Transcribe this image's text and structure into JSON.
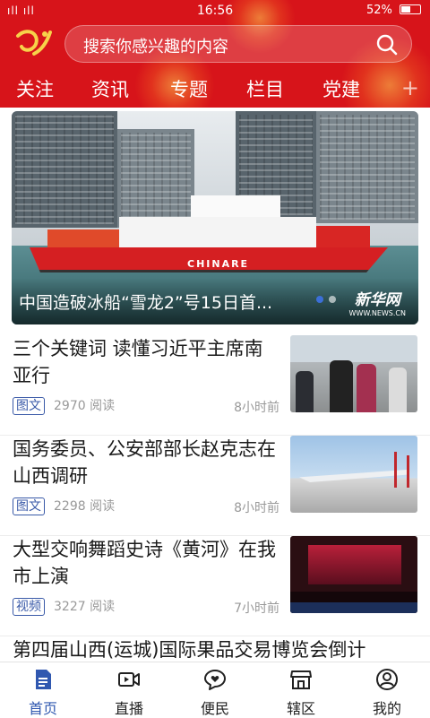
{
  "status_bar": {
    "time": "16:56",
    "battery": "52%",
    "signal": "ıll ıll",
    "battery_level": 0.52
  },
  "search": {
    "placeholder": "搜索你感兴趣的内容"
  },
  "tabs": [
    {
      "label": "关注"
    },
    {
      "label": "资讯"
    },
    {
      "label": "专题"
    },
    {
      "label": "栏目"
    },
    {
      "label": "党建"
    }
  ],
  "tab_add": "+",
  "banner": {
    "caption": "中国造破冰船“雪龙2”号15日首...",
    "ship_text": "CHINARE",
    "watermark_cn": "新华网",
    "watermark_en": "WWW.NEWS.CN"
  },
  "news": [
    {
      "title": "三个关键词 读懂习近平主席南亚行",
      "tag": "图文",
      "reads": "2970 阅读",
      "time": "8小时前"
    },
    {
      "title": "国务委员、公安部部长赵克志在山西调研",
      "tag": "图文",
      "reads": "2298 阅读",
      "time": "8小时前"
    },
    {
      "title": "大型交响舞蹈史诗《黄河》在我市上演",
      "tag": "视频",
      "reads": "3227 阅读",
      "time": "7小时前"
    },
    {
      "title": "第四届山西(运城)国际果品交易博览会倒计"
    }
  ],
  "bottom_nav": [
    {
      "label": "首页",
      "icon": "home-doc-icon",
      "active": true
    },
    {
      "label": "直播",
      "icon": "video-camera-icon"
    },
    {
      "label": "便民",
      "icon": "heart-chat-icon"
    },
    {
      "label": "辖区",
      "icon": "store-icon"
    },
    {
      "label": "我的",
      "icon": "user-icon"
    }
  ],
  "colors": {
    "brand_red": "#d7141a",
    "accent_blue": "#3058b0",
    "tag_blue": "#3a5aa8"
  }
}
